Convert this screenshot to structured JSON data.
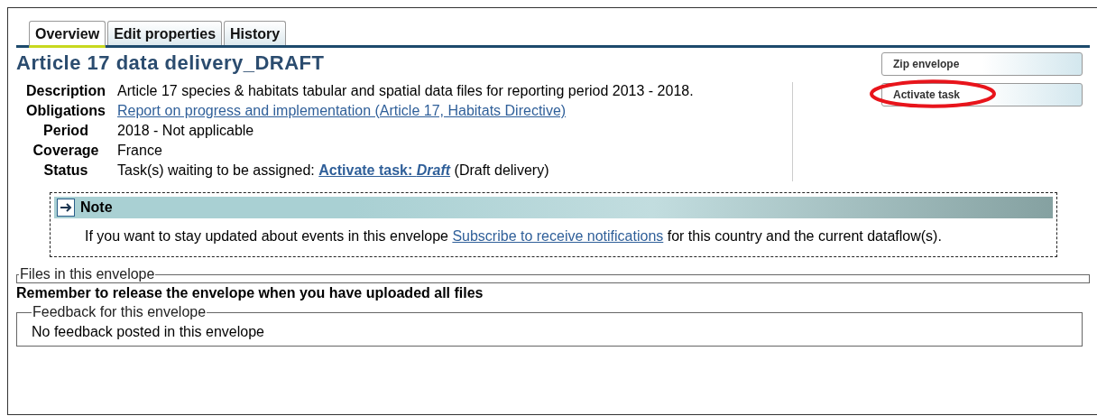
{
  "tabs": [
    {
      "label": "Overview",
      "selected": true
    },
    {
      "label": "Edit properties",
      "selected": false
    },
    {
      "label": "History",
      "selected": false
    }
  ],
  "title": "Article 17 data delivery_DRAFT",
  "actions": [
    {
      "label": "Zip envelope",
      "highlighted": false
    },
    {
      "label": "Activate task",
      "highlighted": true
    }
  ],
  "properties": [
    {
      "label": "Description",
      "parts": [
        {
          "kind": "text",
          "text": "Article 17 species & habitats tabular and spatial data files for reporting period 2013 - 2018."
        }
      ]
    },
    {
      "label": "Obligations",
      "parts": [
        {
          "kind": "link",
          "text": "Report on progress and implementation (Article 17, Habitats Directive)"
        }
      ]
    },
    {
      "label": "Period",
      "parts": [
        {
          "kind": "text",
          "text": "2018 - Not applicable"
        }
      ]
    },
    {
      "label": "Coverage",
      "parts": [
        {
          "kind": "text",
          "text": "France"
        }
      ]
    },
    {
      "label": "Status",
      "parts": [
        {
          "kind": "text",
          "text": "Task(s) waiting to be assigned:"
        },
        {
          "kind": "strong-link",
          "text": "Activate task: *Draft*"
        },
        {
          "kind": "text",
          "text": "(Draft delivery)"
        }
      ]
    }
  ],
  "note": {
    "title": "Note",
    "before": "If you want to stay updated about events in this envelope",
    "link": "Subscribe to receive notifications",
    "after": "for this country and the current dataflow(s)."
  },
  "files": {
    "legend": "Files in this envelope"
  },
  "reminder": "Remember to release the envelope when you have uploaded all files",
  "feedback": {
    "legend": "Feedback for this envelope",
    "text": "No feedback posted in this envelope"
  }
}
